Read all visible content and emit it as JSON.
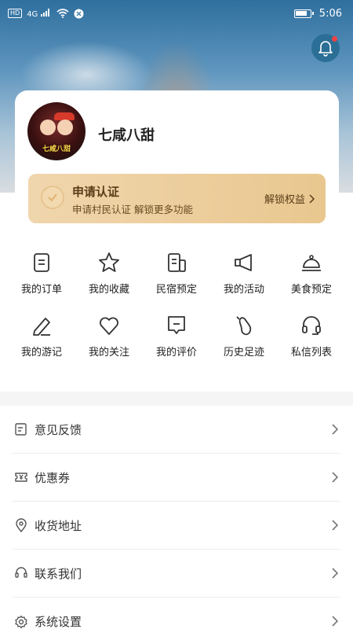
{
  "status_bar": {
    "hd_label": "HD",
    "signal_label": "4G",
    "time": "5:06"
  },
  "profile": {
    "username": "七咸八甜",
    "avatar_text": "七咸八甜"
  },
  "verify": {
    "title": "申请认证",
    "subtitle": "申请村民认证 解锁更多功能",
    "link_label": "解锁权益"
  },
  "grid": {
    "items": [
      {
        "label": "我的订单",
        "icon": "order-icon"
      },
      {
        "label": "我的收藏",
        "icon": "star-icon"
      },
      {
        "label": "民宿预定",
        "icon": "homestay-icon"
      },
      {
        "label": "我的活动",
        "icon": "megaphone-icon"
      },
      {
        "label": "美食预定",
        "icon": "food-cloche-icon"
      },
      {
        "label": "我的游记",
        "icon": "pen-icon"
      },
      {
        "label": "我的关注",
        "icon": "heart-icon"
      },
      {
        "label": "我的评价",
        "icon": "comment-icon"
      },
      {
        "label": "历史足迹",
        "icon": "footprint-icon"
      },
      {
        "label": "私信列表",
        "icon": "headset-icon"
      }
    ]
  },
  "menu": {
    "items": [
      {
        "label": "意见反馈",
        "icon": "feedback-icon"
      },
      {
        "label": "优惠券",
        "icon": "coupon-icon"
      },
      {
        "label": "收货地址",
        "icon": "location-icon"
      },
      {
        "label": "联系我们",
        "icon": "support-icon"
      },
      {
        "label": "系统设置",
        "icon": "settings-icon"
      }
    ]
  },
  "colors": {
    "banner_gold": "#E9C78F",
    "notification_dot": "#F04040",
    "bell_bg": "#2B6F96"
  }
}
